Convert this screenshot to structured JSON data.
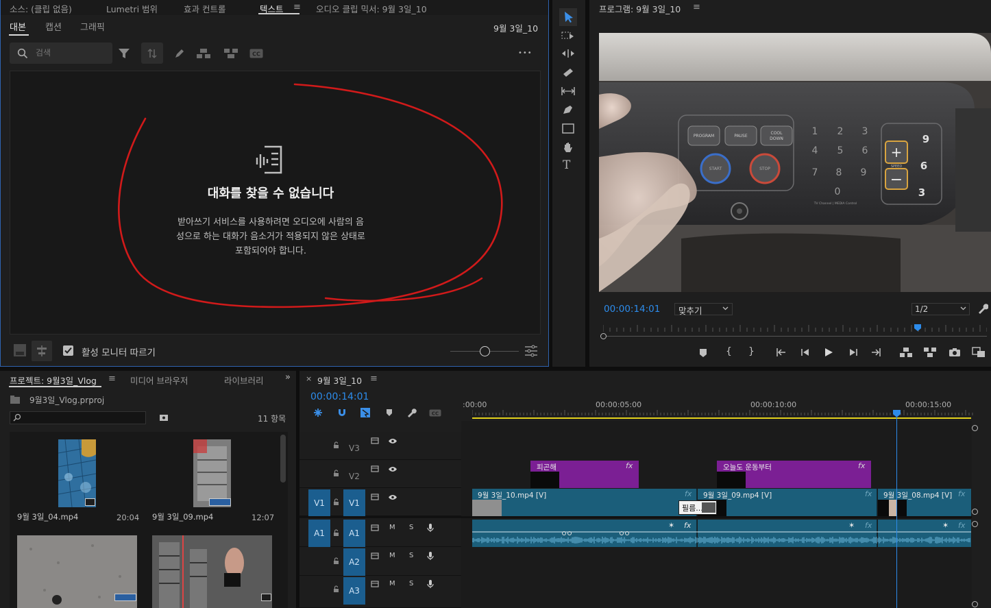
{
  "top_tabs": {
    "source": "소스: (클립 없음)",
    "lumetri": "Lumetri 범위",
    "effects": "효과 컨트롤",
    "text": "텍스트",
    "audio_mixer": "오디오 클립 믹서: 9월 3일_10"
  },
  "text_panel": {
    "subtabs": [
      "대본",
      "캡션",
      "그래픽"
    ],
    "sequence": "9월 3일_10",
    "search_placeholder": "검색",
    "empty_title": "대화를 찾을 수 없습니다",
    "empty_lines": [
      "받아쓰기 서비스를 사용하려면 오디오에 사람의 음",
      "성으로 하는 대화가 음소거가 적용되지 않은 상태로",
      "포함되어야 합니다."
    ],
    "follow_monitor": "활성 모니터 따르기",
    "more": "•••"
  },
  "program": {
    "title": "프로그램: 9월 3일_10",
    "timecode": "00:00:14:01",
    "fit": "맞추기",
    "quality": "1/2",
    "playhead_fraction": 0.82,
    "machine_labels": {
      "program": "PROGRAM",
      "pause": "PAUSE",
      "cool": "COOL",
      "down": "DOWN",
      "start": "START",
      "stop": "STOP",
      "speed": "SPEED",
      "brand": "TV Channel | MEDIA Control"
    }
  },
  "project": {
    "title": "프로젝트: 9월3일_Vlog",
    "media_browser": "미디어 브라우저",
    "library": "라이브러리",
    "file": "9월3일_Vlog.prproj",
    "count": "11 항목",
    "items": [
      {
        "name": "9월 3일_04.mp4",
        "duration": "20:04"
      },
      {
        "name": "9월 3일_09.mp4",
        "duration": "12:07"
      }
    ]
  },
  "timeline": {
    "title": "9월 3일_10",
    "timecode": "00:00:14:01",
    "ruler": [
      ":00:00",
      "00:00:05:00",
      "00:00:10:00",
      "00:00:15:00"
    ],
    "tracks": [
      {
        "src": "",
        "name": "V3"
      },
      {
        "src": "",
        "name": "V2"
      },
      {
        "src": "V1",
        "name": "V1"
      },
      {
        "src": "A1",
        "name": "A1"
      },
      {
        "src": "",
        "name": "A2"
      },
      {
        "src": "",
        "name": "A3"
      }
    ],
    "track_toggles": {
      "mute": "M",
      "solo": "S"
    },
    "v2_clips": [
      "피곤해",
      "오늘도 운동부터"
    ],
    "v1_clips": [
      "9월 3일_10.mp4 [V]",
      "9월 3일_09.mp4 [V]",
      "9월 3일_08.mp4 [V]"
    ],
    "tooltip": "필름...",
    "fx": "fx"
  },
  "colors": {
    "accent": "#2d8ceb",
    "video_clip": "#1b5e7a",
    "graphic_clip": "#7b1f94",
    "annotation": "#d11a1a"
  }
}
